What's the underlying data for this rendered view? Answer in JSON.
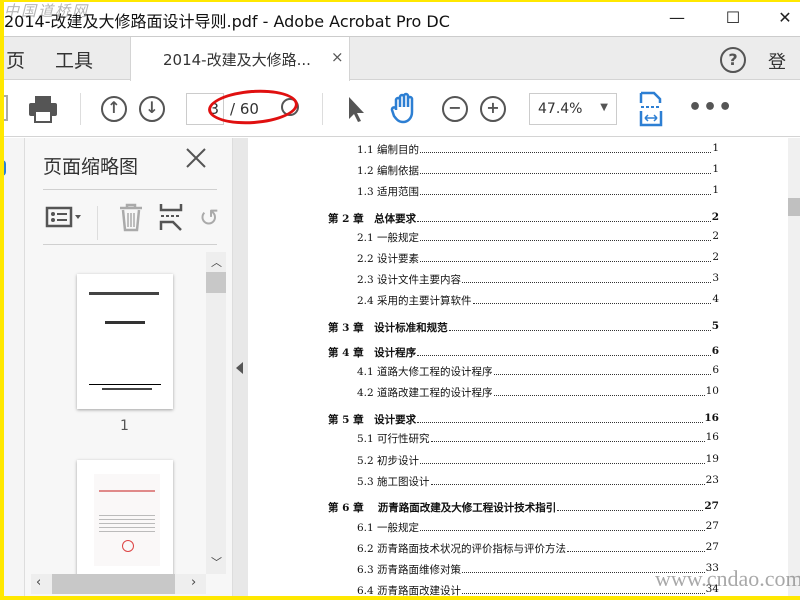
{
  "watermark_top": "中国道桥网",
  "watermark_bottom": "www.cndao.com",
  "window": {
    "title": "2014-改建及大修路面设计导则.pdf - Adobe Acrobat Pro DC",
    "min": "—",
    "max": "☐",
    "close": "✕"
  },
  "tabs": {
    "home": "页",
    "tools": "工具",
    "doc": "2014-改建及大修路...",
    "close": "×",
    "help": "?",
    "login": "登"
  },
  "toolbar": {
    "page_current": "3",
    "page_total": "/ 60",
    "zoom": "47.4%"
  },
  "panel": {
    "title": "页面缩略图",
    "close": "✕",
    "thumb1_label": "1"
  },
  "toc": [
    {
      "t": "1.1 编制目的",
      "p": "1",
      "ch": false
    },
    {
      "t": "1.2 编制依据",
      "p": "1",
      "ch": false
    },
    {
      "t": "1.3 适用范围",
      "p": "1",
      "ch": false
    },
    {
      "t": "第 2 章　总体要求",
      "p": "2",
      "ch": true
    },
    {
      "t": "2.1 一般规定",
      "p": "2",
      "ch": false
    },
    {
      "t": "2.2 设计要素",
      "p": "2",
      "ch": false
    },
    {
      "t": "2.3  设计文件主要内容",
      "p": "3",
      "ch": false
    },
    {
      "t": "2.4  采用的主要计算软件",
      "p": "4",
      "ch": false
    },
    {
      "t": "第 3 章　设计标准和规范",
      "p": "5",
      "ch": true
    },
    {
      "t": "第 4 章　设计程序",
      "p": "6",
      "ch": true
    },
    {
      "t": "4.1 道路大修工程的设计程序",
      "p": "6",
      "ch": false
    },
    {
      "t": "4.2 道路改建工程的设计程序",
      "p": "10",
      "ch": false
    },
    {
      "t": "第 5 章　设计要求",
      "p": "16",
      "ch": true
    },
    {
      "t": "5.1  可行性研究",
      "p": "16",
      "ch": false
    },
    {
      "t": "5.2  初步设计",
      "p": "19",
      "ch": false
    },
    {
      "t": "5.3  施工图设计",
      "p": "23",
      "ch": false
    },
    {
      "t": "第 6 章　 沥青路面改建及大修工程设计技术指引",
      "p": "27",
      "ch": true
    },
    {
      "t": "6.1 一般规定",
      "p": "27",
      "ch": false
    },
    {
      "t": "6.2 沥青路面技术状况的评价指标与评价方法",
      "p": "27",
      "ch": false
    },
    {
      "t": "6.3 沥青路面维修对策",
      "p": "33",
      "ch": false
    },
    {
      "t": "6.4 沥青路面改建设计",
      "p": "34",
      "ch": false
    }
  ],
  "colors": {
    "annotation": "#e01010",
    "frame": "#ffe800",
    "accent": "#2d7fd3"
  }
}
